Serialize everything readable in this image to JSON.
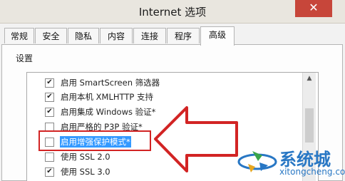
{
  "window": {
    "title": "Internet 选项",
    "close_glyph": "✕"
  },
  "tabs": [
    {
      "label": "常规"
    },
    {
      "label": "安全"
    },
    {
      "label": "隐私"
    },
    {
      "label": "内容"
    },
    {
      "label": "连接"
    },
    {
      "label": "程序"
    },
    {
      "label": "高级",
      "active": true
    }
  ],
  "settings": {
    "group_label": "设置",
    "items": [
      {
        "label": "启用 SmartScreen 筛选器",
        "checked": true
      },
      {
        "label": "启用本机 XMLHTTP 支持",
        "checked": true
      },
      {
        "label": "启用集成 Windows 验证*",
        "checked": true
      },
      {
        "label": "启用严格的 P3P 验证*",
        "checked": false
      },
      {
        "label": "启用增强保护模式*",
        "checked": false,
        "selected": true
      },
      {
        "label": "使用 SSL 2.0",
        "checked": false
      },
      {
        "label": "使用 SSL 3.0",
        "checked": true
      }
    ]
  },
  "watermark": {
    "name": "系统城",
    "url": "xitongcheng.com"
  },
  "colors": {
    "annotation_red": "#d22424",
    "selection_blue": "#3399ff",
    "watermark_blue": "#2877c4"
  }
}
